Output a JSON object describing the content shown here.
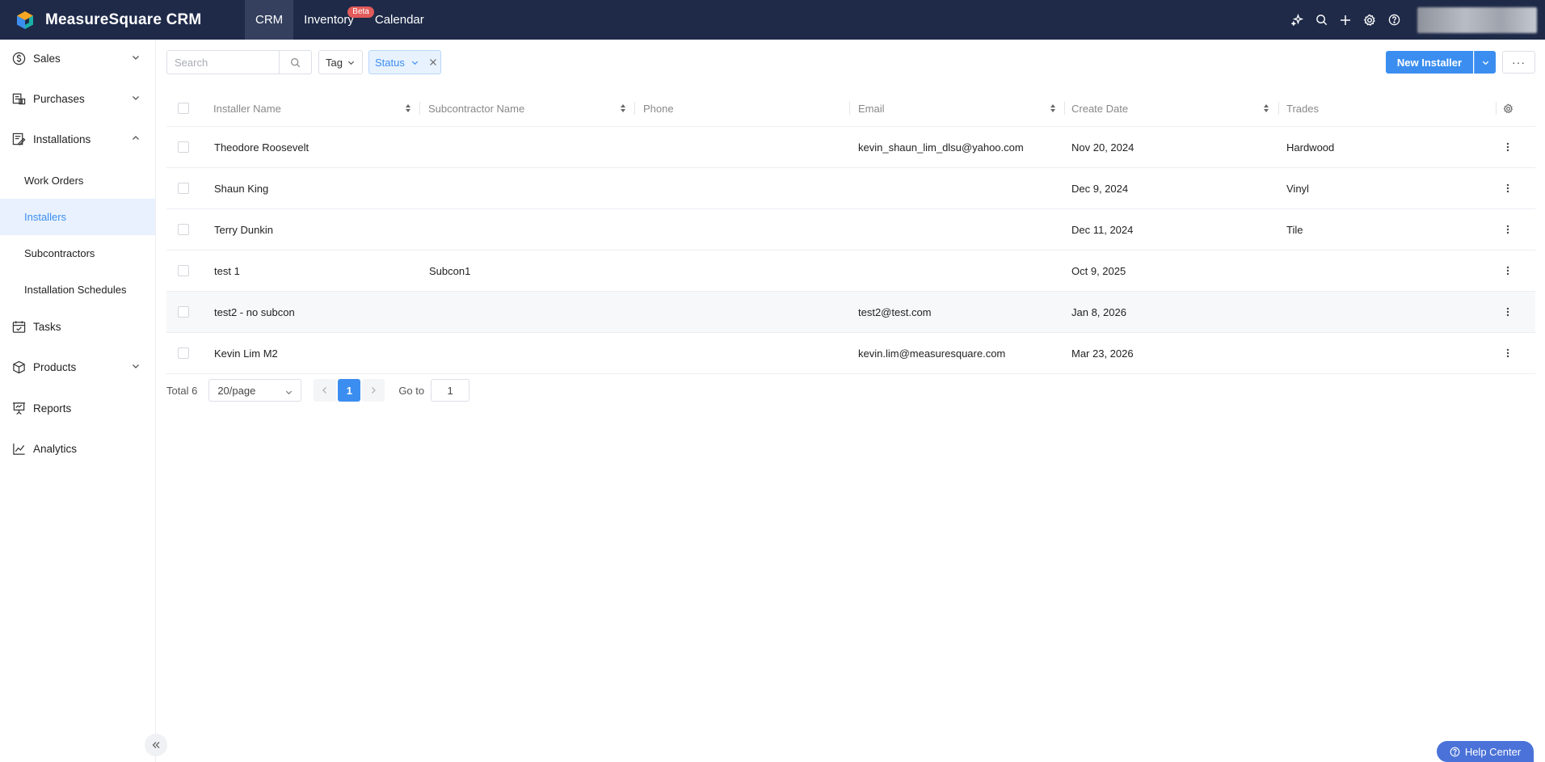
{
  "brand": {
    "name": "MeasureSquare CRM"
  },
  "topnav": [
    {
      "label": "CRM",
      "active": true
    },
    {
      "label": "Inventory",
      "badge": "Beta"
    },
    {
      "label": "Calendar"
    }
  ],
  "sidebar": {
    "items": [
      {
        "label": "Sales",
        "icon": "dollar-circle-icon",
        "expandable": true
      },
      {
        "label": "Purchases",
        "icon": "purchase-box-icon",
        "expandable": true
      },
      {
        "label": "Installations",
        "icon": "installations-icon",
        "expanded": true
      },
      {
        "label": "Tasks",
        "icon": "calendar-check-icon"
      },
      {
        "label": "Products",
        "icon": "cube-icon",
        "expandable": true
      },
      {
        "label": "Reports",
        "icon": "presentation-icon"
      },
      {
        "label": "Analytics",
        "icon": "line-chart-icon"
      }
    ],
    "installations_sub": [
      {
        "label": "Work Orders"
      },
      {
        "label": "Installers",
        "active": true
      },
      {
        "label": "Subcontractors"
      },
      {
        "label": "Installation Schedules"
      }
    ]
  },
  "toolbar": {
    "search_placeholder": "Search",
    "search_value": "",
    "tag_label": "Tag",
    "status_label": "Status",
    "new_label": "New Installer",
    "more_label": "···"
  },
  "table": {
    "columns": [
      "Installer Name",
      "Subcontractor Name",
      "Phone",
      "Email",
      "Create Date",
      "Trades"
    ],
    "rows": [
      {
        "name": "Theodore Roosevelt",
        "subcon": "",
        "phone": "",
        "email": "kevin_shaun_lim_dlsu@yahoo.com",
        "date": "Nov 20, 2024",
        "trades": "Hardwood"
      },
      {
        "name": "Shaun King",
        "subcon": "",
        "phone": "",
        "email": "",
        "date": "Dec 9, 2024",
        "trades": "Vinyl"
      },
      {
        "name": "Terry Dunkin",
        "subcon": "",
        "phone": "",
        "email": "",
        "date": "Dec 11, 2024",
        "trades": "Tile"
      },
      {
        "name": "test 1",
        "subcon": "Subcon1",
        "phone": "",
        "email": "",
        "date": "Oct 9, 2025",
        "trades": ""
      },
      {
        "name": "test2 - no subcon",
        "subcon": "",
        "phone": "",
        "email": "test2@test.com",
        "date": "Jan 8, 2026",
        "trades": ""
      },
      {
        "name": "Kevin Lim M2",
        "subcon": "",
        "phone": "",
        "email": "kevin.lim@measuresquare.com",
        "date": "Mar 23, 2026",
        "trades": ""
      }
    ]
  },
  "pagination": {
    "total": "Total 6",
    "page_size": "20/page",
    "current_page": "1",
    "goto_label": "Go to",
    "goto_value": "1"
  },
  "help": {
    "label": "Help Center"
  },
  "colors": {
    "topbar": "#1e2a48",
    "accent": "#3b8ef0",
    "help": "#4a72d8"
  }
}
